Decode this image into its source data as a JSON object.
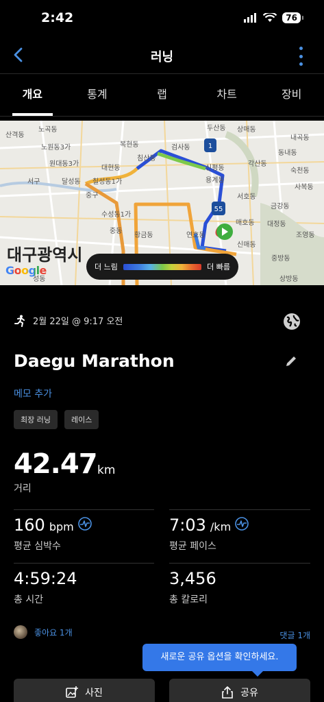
{
  "status": {
    "time": "2:42",
    "battery": "76"
  },
  "nav": {
    "title": "러닝"
  },
  "tabs": [
    {
      "label": "개요",
      "active": true
    },
    {
      "label": "통계"
    },
    {
      "label": "랩"
    },
    {
      "label": "차트"
    },
    {
      "label": "장비"
    }
  ],
  "map": {
    "labels": [
      "노곡동",
      "침산동",
      "원대동3가",
      "대현동",
      "달성동",
      "칠성동1가",
      "서구",
      "중구",
      "수성동1가",
      "중동",
      "황금동",
      "두산동",
      "상매동",
      "검사동",
      "신평동",
      "용계동",
      "서호동",
      "매호동",
      "신매동",
      "연호동",
      "각산동",
      "숙천동",
      "사복동",
      "금강동",
      "대정동",
      "조영동",
      "중방동",
      "상방동",
      "내곡동",
      "동내동",
      "노원동3가",
      "복현동",
      "성동",
      "산격동"
    ],
    "big_label": "대구광역시",
    "google": "Google",
    "highway_1": "1",
    "highway_55": "55",
    "legend_slow": "더 느림",
    "legend_fast": "더 빠름"
  },
  "activity": {
    "date": "2월 22일 @ 9:17 오전",
    "title": "Daegu Marathon",
    "add_memo": "메모 추가",
    "tags": [
      "최장 러닝",
      "레이스"
    ],
    "distance": {
      "value": "42.47",
      "unit": "km",
      "label": "거리"
    },
    "stats": [
      {
        "value": "160",
        "unit": "bpm",
        "label": "평균 심박수"
      },
      {
        "value": "7:03",
        "unit": "/km",
        "label": "평균 페이스"
      },
      {
        "value": "4:59:24",
        "unit": "",
        "label": "총 시간"
      },
      {
        "value": "3,456",
        "unit": "",
        "label": "총 칼로리"
      }
    ],
    "likes": "좋아요 1개",
    "comments": "댓글 1개",
    "tooltip": "새로운 공유 옵션을 확인하세요.",
    "photo_button": "사진",
    "share_button": "공유"
  },
  "colors": {
    "accent": "#4a90e2",
    "tooltip": "#3478e8",
    "chip": "#2a2a2a",
    "button": "#2d2d2d"
  },
  "icons": [
    "back-icon",
    "more-icon",
    "runner-icon",
    "globe-icon",
    "edit-icon",
    "heart-rate-icon",
    "add-photo-icon",
    "share-icon",
    "start-marker-icon",
    "end-marker-icon"
  ]
}
